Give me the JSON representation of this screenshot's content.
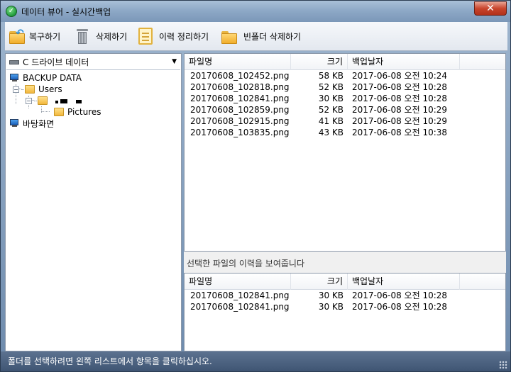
{
  "window": {
    "title": "데이터 뷰어 - 실시간백업",
    "close_glyph": "✕"
  },
  "toolbar": {
    "restore_label": "복구하기",
    "delete_label": "삭제하기",
    "cleanup_label": "이력 정리하기",
    "empty_folder_label": "빈폴더 삭제하기"
  },
  "drive_select": {
    "selected": "C 드라이브 데이터"
  },
  "tree": {
    "root": "BACKUP DATA",
    "users": "Users",
    "pictures": "Pictures",
    "desktop": "바탕화면"
  },
  "file_list": {
    "columns": {
      "name": "파일명",
      "size": "크기",
      "date": "백업날자"
    },
    "rows": [
      {
        "name": "20170608_102452.png",
        "size": "58 KB",
        "date": "2017-06-08 오전 10:24"
      },
      {
        "name": "20170608_102818.png",
        "size": "52 KB",
        "date": "2017-06-08 오전 10:28"
      },
      {
        "name": "20170608_102841.png",
        "size": "30 KB",
        "date": "2017-06-08 오전 10:28"
      },
      {
        "name": "20170608_102859.png",
        "size": "52 KB",
        "date": "2017-06-08 오전 10:29"
      },
      {
        "name": "20170608_102915.png",
        "size": "41 KB",
        "date": "2017-06-08 오전 10:29"
      },
      {
        "name": "20170608_103835.png",
        "size": "43 KB",
        "date": "2017-06-08 오전 10:38"
      }
    ]
  },
  "history": {
    "caption": "선택한 파일의 이력을 보여줍니다",
    "columns": {
      "name": "파일명",
      "size": "크기",
      "date": "백업날자"
    },
    "rows": [
      {
        "name": "20170608_102841.png",
        "size": "30 KB",
        "date": "2017-06-08 오전 10:28"
      },
      {
        "name": "20170608_102841.png",
        "size": "30 KB",
        "date": "2017-06-08 오전 10:28"
      }
    ]
  },
  "status": {
    "text": "폴더를 선택하려면 왼쪽 리스트에서 항목을 클릭하십시오."
  }
}
